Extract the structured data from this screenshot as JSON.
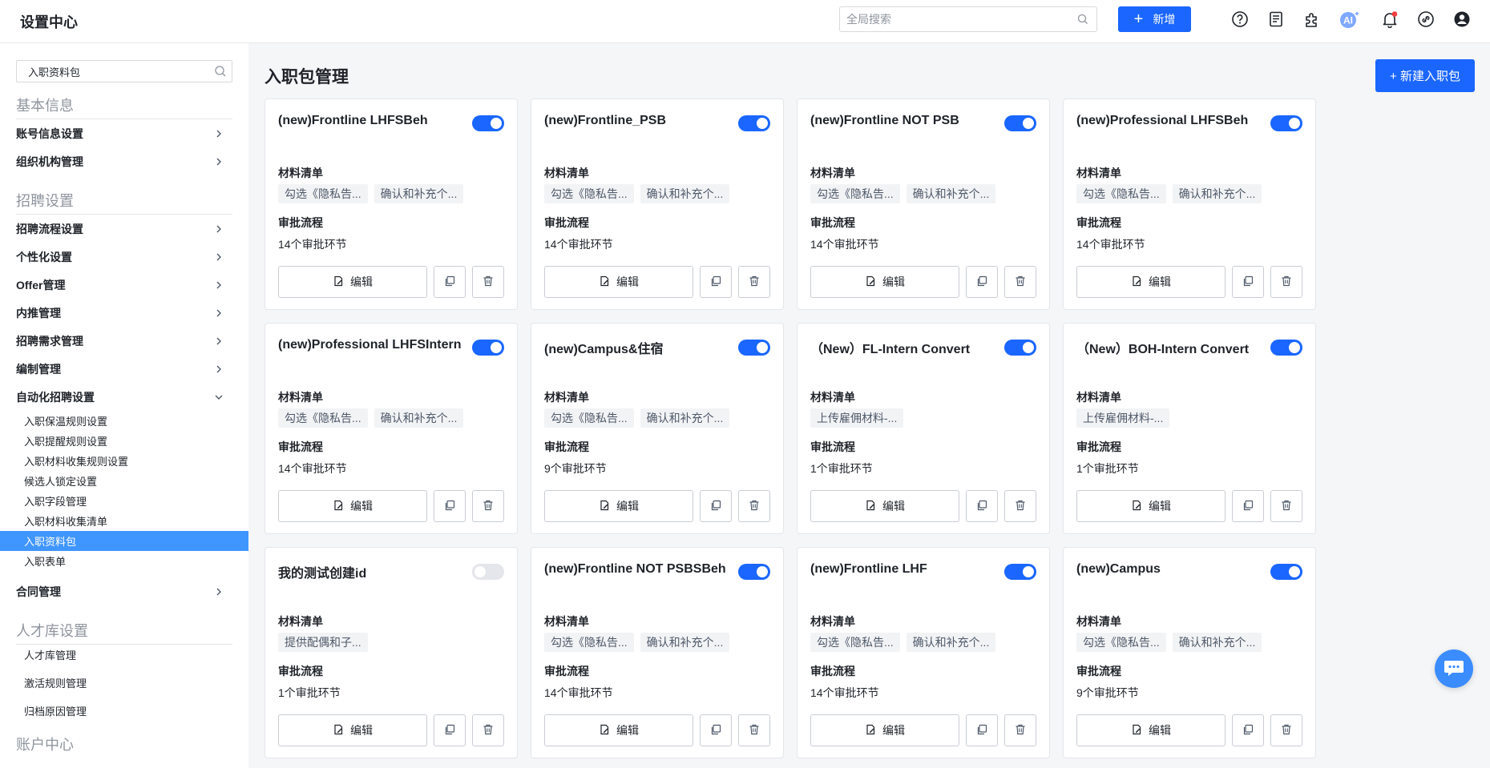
{
  "app": {
    "title": "设置中心"
  },
  "header": {
    "search_placeholder": "全局搜索",
    "add_label": "新增",
    "ai_label": "AI"
  },
  "sidebar": {
    "search_value": "入职资料包",
    "groups": [
      {
        "title": "基本信息"
      },
      {
        "title": "招聘设置"
      },
      {
        "title": "人才库设置"
      },
      {
        "title": "账户中心"
      }
    ],
    "items": {
      "account": "账号信息设置",
      "org": "组织机构管理",
      "flow": "招聘流程设置",
      "personal": "个性化设置",
      "offer": "Offer管理",
      "referral": "内推管理",
      "demand": "招聘需求管理",
      "headcount": "编制管理",
      "automation": "自动化招聘设置",
      "contract": "合同管理"
    },
    "automation_sub": [
      "入职保温规则设置",
      "入职提醒规则设置",
      "入职材料收集规则设置",
      "候选人锁定设置",
      "入职字段管理",
      "入职材料收集清单",
      "入职资料包",
      "入职表单"
    ],
    "talent_sub": [
      "人才库管理",
      "激活规则管理",
      "归档原因管理"
    ]
  },
  "main": {
    "title": "入职包管理",
    "new_button": "+ 新建入职包",
    "labels": {
      "materials": "材料清单",
      "approval": "审批流程",
      "edit": "编辑"
    },
    "cards": [
      {
        "title": "(new)Frontline LHFSBeh",
        "enabled": true,
        "tags": [
          "勾选《隐私告...",
          "确认和补充个..."
        ],
        "approval": "14个审批环节"
      },
      {
        "title": "(new)Frontline_PSB",
        "enabled": true,
        "tags": [
          "勾选《隐私告...",
          "确认和补充个..."
        ],
        "approval": "14个审批环节"
      },
      {
        "title": "(new)Frontline NOT PSB",
        "enabled": true,
        "tags": [
          "勾选《隐私告...",
          "确认和补充个..."
        ],
        "approval": "14个审批环节"
      },
      {
        "title": "(new)Professional LHFSBeh",
        "enabled": true,
        "tags": [
          "勾选《隐私告...",
          "确认和补充个..."
        ],
        "approval": "14个审批环节"
      },
      {
        "title": "(new)Professional LHFSIntern",
        "enabled": true,
        "tags": [
          "勾选《隐私告...",
          "确认和补充个..."
        ],
        "approval": "14个审批环节"
      },
      {
        "title": "(new)Campus&住宿",
        "enabled": true,
        "tags": [
          "勾选《隐私告...",
          "确认和补充个..."
        ],
        "approval": "9个审批环节"
      },
      {
        "title": "（New）FL-Intern Convert",
        "enabled": true,
        "tags": [
          "上传雇佣材料-..."
        ],
        "approval": "1个审批环节"
      },
      {
        "title": "（New）BOH-Intern Convert",
        "enabled": true,
        "tags": [
          "上传雇佣材料-..."
        ],
        "approval": "1个审批环节"
      },
      {
        "title": "我的测试创建id",
        "enabled": false,
        "tags": [
          "提供配偶和子..."
        ],
        "approval": "1个审批环节"
      },
      {
        "title": "(new)Frontline NOT PSBSBeh",
        "enabled": true,
        "tags": [
          "勾选《隐私告...",
          "确认和补充个..."
        ],
        "approval": "14个审批环节"
      },
      {
        "title": "(new)Frontline LHF",
        "enabled": true,
        "tags": [
          "勾选《隐私告...",
          "确认和补充个..."
        ],
        "approval": "14个审批环节"
      },
      {
        "title": "(new)Campus",
        "enabled": true,
        "tags": [
          "勾选《隐私告...",
          "确认和补充个..."
        ],
        "approval": "9个审批环节"
      }
    ]
  },
  "colors": {
    "primary": "#1a66ff",
    "active_menu": "#4096ff",
    "notification": "#f53f3f"
  }
}
